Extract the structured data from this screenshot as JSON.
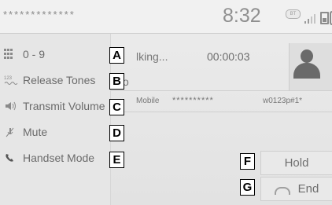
{
  "status_bar": {
    "device_name": "*************",
    "clock": "8:32",
    "bt_badge": "BT"
  },
  "menu": {
    "items": [
      {
        "label": "0 - 9",
        "icon": "keypad-icon",
        "callout": "A"
      },
      {
        "label": "Release Tones",
        "icon": "release-tones-icon",
        "callout": "B"
      },
      {
        "label": "Transmit Volume",
        "icon": "speaker-icon",
        "callout": "C"
      },
      {
        "label": "Mute",
        "icon": "mute-icon",
        "callout": "D"
      },
      {
        "label": "Handset Mode",
        "icon": "handset-icon",
        "callout": "E"
      }
    ]
  },
  "call": {
    "status": "lking...",
    "timer": "00:00:03",
    "contact_fragment": "o",
    "number_type": "Mobile",
    "number": "**********",
    "number_extra": "w0123p#1*"
  },
  "buttons": {
    "hold": {
      "label": "Hold",
      "callout": "F"
    },
    "end": {
      "label": "End",
      "callout": "G"
    }
  },
  "colors": {
    "background": "#e6e6e6",
    "text": "#6b6b6b",
    "callout_border": "#000000"
  }
}
